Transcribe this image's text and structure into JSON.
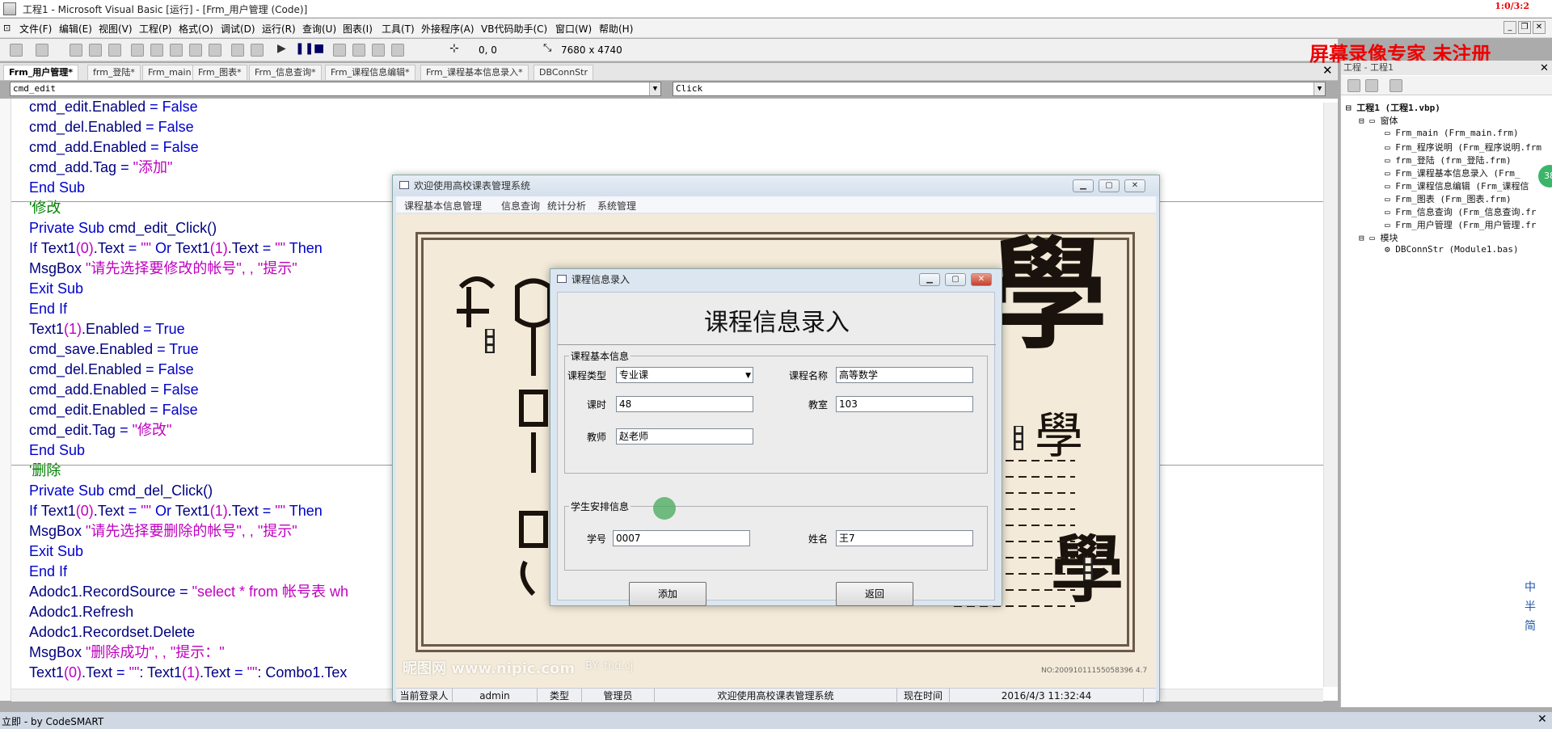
{
  "window": {
    "title": "工程1 - Microsoft Visual Basic [运行] - [Frm_用户管理 (Code)]",
    "rec_stamp": "1:0/3:2"
  },
  "menubar": {
    "items": [
      "文件(F)",
      "编辑(E)",
      "视图(V)",
      "工程(P)",
      "格式(O)",
      "调试(D)",
      "运行(R)",
      "查询(U)",
      "图表(I)",
      "工具(T)",
      "外接程序(A)",
      "VB代码助手(C)",
      "窗口(W)",
      "帮助(H)"
    ]
  },
  "toolbar": {
    "position": "0, 0",
    "size": "7680 x 4740",
    "watermark": "屏幕录像专家 未注册"
  },
  "tabs": [
    "Frm_用户管理*",
    "frm_登陆*",
    "Frm_main",
    "Frm_图表*",
    "Frm_信息查询*",
    "Frm_课程信息编辑*",
    "Frm_课程基本信息录入*",
    "DBConnStr"
  ],
  "object_combo": "cmd_edit",
  "proc_combo": "Click",
  "code_lines": [
    [
      [
        "pl",
        "cmd_edit.Enabled "
      ],
      [
        "kw",
        "= False"
      ]
    ],
    [
      [
        "pl",
        "cmd_del.Enabled "
      ],
      [
        "kw",
        "= False"
      ]
    ],
    [
      [
        "pl",
        "cmd_add.Enabled "
      ],
      [
        "kw",
        "= False"
      ]
    ],
    [
      [
        "pl",
        "cmd_add.Tag "
      ],
      [
        "kw",
        "= "
      ],
      [
        "str",
        "\"添加\""
      ]
    ],
    [
      [
        "kw",
        "End Sub"
      ]
    ],
    [
      [
        "cm",
        "'修改"
      ]
    ],
    [
      [
        "kw",
        "Private Sub "
      ],
      [
        "pl",
        "cmd_edit_Click()"
      ]
    ],
    [
      [
        "kw",
        "If "
      ],
      [
        "pl",
        "Text1"
      ],
      [
        "str",
        "(0)"
      ],
      [
        "pl",
        ".Text "
      ],
      [
        "kw",
        "= "
      ],
      [
        "str",
        "\"\""
      ],
      [
        "kw",
        " Or "
      ],
      [
        "pl",
        "Text1"
      ],
      [
        "str",
        "(1)"
      ],
      [
        "pl",
        ".Text "
      ],
      [
        "kw",
        "= "
      ],
      [
        "str",
        "\"\""
      ],
      [
        "kw",
        " Then"
      ]
    ],
    [
      [
        "pl",
        "MsgBox "
      ],
      [
        "str",
        "\"请先选择要修改的帐号\", , \"提示\""
      ]
    ],
    [
      [
        "kw",
        "Exit Sub"
      ]
    ],
    [
      [
        "kw",
        "End If"
      ]
    ],
    [
      [
        "pl",
        "Text1"
      ],
      [
        "str",
        "(1)"
      ],
      [
        "pl",
        ".Enabled "
      ],
      [
        "kw",
        "= True"
      ]
    ],
    [
      [
        "pl",
        "cmd_save.Enabled "
      ],
      [
        "kw",
        "= True"
      ]
    ],
    [
      [
        "pl",
        "cmd_del.Enabled "
      ],
      [
        "kw",
        "= False"
      ]
    ],
    [
      [
        "pl",
        "cmd_add.Enabled "
      ],
      [
        "kw",
        "= False"
      ]
    ],
    [
      [
        "pl",
        "cmd_edit.Enabled "
      ],
      [
        "kw",
        "= False"
      ]
    ],
    [
      [
        "pl",
        "cmd_edit.Tag "
      ],
      [
        "kw",
        "= "
      ],
      [
        "str",
        "\"修改\""
      ]
    ],
    [
      [
        "kw",
        "End Sub"
      ]
    ],
    [
      [
        "cm",
        "'删除"
      ]
    ],
    [
      [
        "kw",
        "Private Sub "
      ],
      [
        "pl",
        "cmd_del_Click()"
      ]
    ],
    [
      [
        "kw",
        "If "
      ],
      [
        "pl",
        "Text1"
      ],
      [
        "str",
        "(0)"
      ],
      [
        "pl",
        ".Text "
      ],
      [
        "kw",
        "= "
      ],
      [
        "str",
        "\"\""
      ],
      [
        "kw",
        " Or "
      ],
      [
        "pl",
        "Text1"
      ],
      [
        "str",
        "(1)"
      ],
      [
        "pl",
        ".Text "
      ],
      [
        "kw",
        "= "
      ],
      [
        "str",
        "\"\""
      ],
      [
        "kw",
        " Then"
      ]
    ],
    [
      [
        "pl",
        "MsgBox "
      ],
      [
        "str",
        "\"请先选择要删除的帐号\", , \"提示\""
      ]
    ],
    [
      [
        "kw",
        "Exit Sub"
      ]
    ],
    [
      [
        "kw",
        "End If"
      ]
    ],
    [
      [
        "pl",
        "Adodc1.RecordSource "
      ],
      [
        "kw",
        "= "
      ],
      [
        "str",
        "\"select * from 帐号表 wh"
      ]
    ],
    [
      [
        "pl",
        "Adodc1.Refresh"
      ]
    ],
    [
      [
        "pl",
        "Adodc1.Recordset.Delete"
      ]
    ],
    [
      [
        "pl",
        "MsgBox "
      ],
      [
        "str",
        "\"删除成功\", , \"提示：\""
      ]
    ],
    [
      [
        "pl",
        "Text1"
      ],
      [
        "str",
        "(0)"
      ],
      [
        "pl",
        ".Text "
      ],
      [
        "kw",
        "= "
      ],
      [
        "str",
        "\"\""
      ],
      [
        "pl",
        ": Text1"
      ],
      [
        "str",
        "(1)"
      ],
      [
        "pl",
        ".Text "
      ],
      [
        "kw",
        "= "
      ],
      [
        "str",
        "\"\""
      ],
      [
        "pl",
        ": Combo1.Tex"
      ]
    ]
  ],
  "bottom": {
    "label": "立即 - by CodeSMART"
  },
  "project": {
    "title": "工程 - 工程1",
    "root": "工程1 (工程1.vbp)",
    "forms_folder": "窗体",
    "forms": [
      "Frm_main (Frm_main.frm)",
      "Frm_程序说明 (Frm_程序说明.frm",
      "frm_登陆 (frm_登陆.frm)",
      "Frm_课程基本信息录入 (Frm_",
      "Frm_课程信息编辑 (Frm_课程信",
      "Frm_图表 (Frm_图表.frm)",
      "Frm_信息查询 (Frm_信息查询.fr",
      "Frm_用户管理 (Frm_用户管理.fr"
    ],
    "modules_folder": "模块",
    "modules": [
      "DBConnStr (Module1.bas)"
    ],
    "green_badge": "38"
  },
  "ime": [
    "中",
    "半",
    "简"
  ],
  "app": {
    "title": "欢迎使用高校课表管理系统",
    "menu": [
      "课程基本信息管理",
      "信息查询",
      "统计分析",
      "系统管理"
    ],
    "bg_chars": {
      "big1": "學",
      "big2": "學",
      "small": "學"
    },
    "bg_watermark": "昵图网 www.nipic.com",
    "bg_by": "BY: thd.cj",
    "bg_id": "NO:20091011155058396 4.7",
    "status": {
      "login_label": "当前登录人",
      "user": "admin",
      "type_label": "类型",
      "type": "管理员",
      "welcome": "欢迎使用高校课表管理系统",
      "time_label": "现在时间",
      "time": "2016/4/3 11:32:44"
    }
  },
  "dialog": {
    "title": "课程信息录入",
    "heading": "课程信息录入",
    "group1": "课程基本信息",
    "course_type_label": "课程类型",
    "course_type": "专业课",
    "course_name_label": "课程名称",
    "course_name": "高等数学",
    "hours_label": "课时",
    "hours": "48",
    "room_label": "教室",
    "room": "103",
    "teacher_label": "教师",
    "teacher": "赵老师",
    "group2": "学生安排信息",
    "stuid_label": "学号",
    "stuid": "0007",
    "stuname_label": "姓名",
    "stuname": "王7",
    "add_btn": "添加",
    "back_btn": "返回"
  }
}
